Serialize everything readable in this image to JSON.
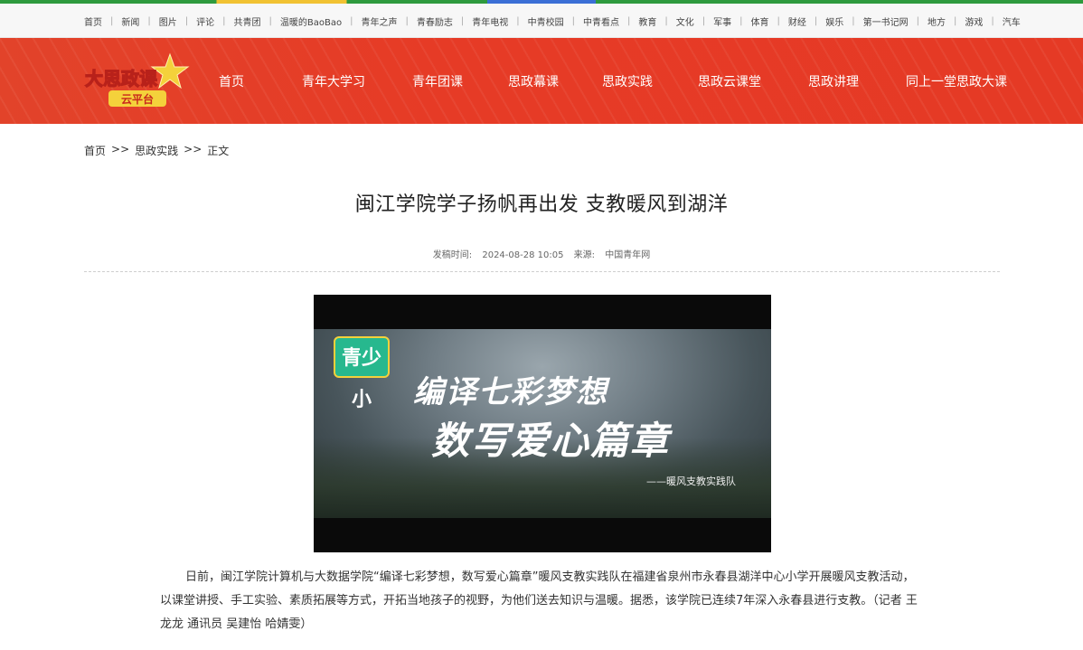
{
  "top_nav": {
    "items": [
      "首页",
      "新闻",
      "图片",
      "评论",
      "共青团",
      "温暖的BaoBao",
      "青年之声",
      "青春励志",
      "青年电视",
      "中青校园",
      "中青看点",
      "教育",
      "文化",
      "军事",
      "体育",
      "财经",
      "娱乐",
      "第一书记网",
      "地方",
      "游戏",
      "汽车"
    ]
  },
  "header": {
    "logo_text": "大思政课",
    "logo_sub": "云平台",
    "nav": [
      "首页",
      "青年大学习",
      "青年团课",
      "思政幕课",
      "思政实践",
      "思政云课堂",
      "思政讲理",
      "同上一堂思政大课"
    ]
  },
  "breadcrumb": {
    "home": "首页",
    "sep1": ">>",
    "section": "思政实践",
    "sep2": ">>",
    "current": "正文"
  },
  "article": {
    "title": "闽江学院学子扬帆再出发 支教暖风到湖洋",
    "meta": {
      "time_label": "发稿时间:",
      "time": "2024-08-28 10:05",
      "source_label": "来源:",
      "source": "中国青年网"
    },
    "video": {
      "badge": "青少小",
      "line1": "编译七彩梦想",
      "line2": "数写爱心篇章",
      "credit": "——暖风支教实践队"
    },
    "body": "日前，闽江学院计算机与大数据学院“编译七彩梦想，数写爱心篇章”暖风支教实践队在福建省泉州市永春县湖洋中心小学开展暖风支教活动，以课堂讲授、手工实验、素质拓展等方式，开拓当地孩子的视野，为他们送去知识与温暖。据悉，该学院已连续7年深入永春县进行支教。（记者 王龙龙 通讯员 吴建怡 哈婧雯）"
  },
  "colors": {
    "header_red": "#e53a25",
    "logo_yellow": "#f4d13b",
    "badge_green": "#27b88e"
  }
}
